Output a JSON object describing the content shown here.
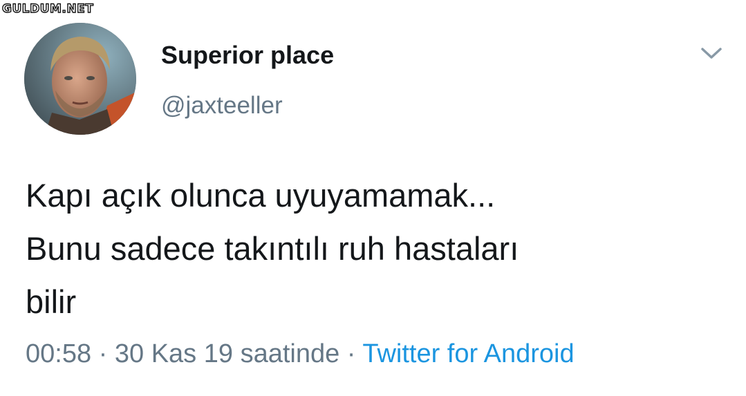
{
  "watermark": {
    "text": "GULDUM.NET"
  },
  "tweet": {
    "author": {
      "display_name": "Superior place",
      "handle": "@jaxteeller",
      "avatar_icon": "profile-photo"
    },
    "menu_icon": "chevron-down-icon",
    "text_lines": [
      "Kapı açık olunca uyuyamamak...",
      "Bunu sadece takıntılı ruh hastaları",
      "bilir"
    ],
    "meta": {
      "time": "00:58",
      "separator": "·",
      "date": "30 Kas 19 saatinde",
      "source": "Twitter for Android"
    }
  },
  "colors": {
    "text_primary": "#14171a",
    "text_secondary": "#657786",
    "link": "#1b95e0",
    "background": "#ffffff"
  }
}
